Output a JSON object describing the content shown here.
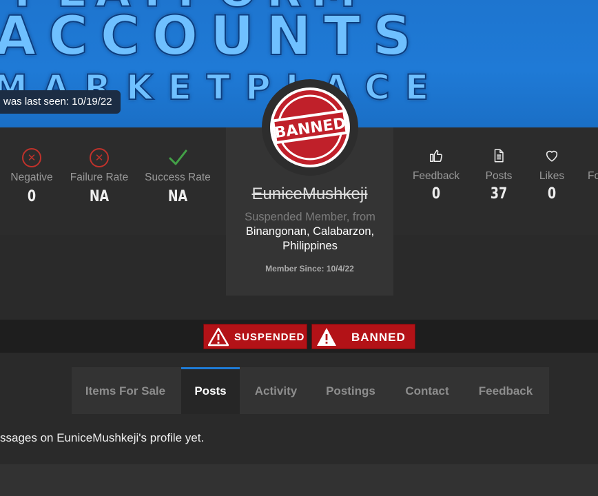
{
  "banner": {
    "line1": "PLATFORM",
    "line2": "ACCOUNTS",
    "line3": "MARKETPLACE",
    "last_seen": "was last seen: 10/19/22"
  },
  "stats_left": [
    {
      "label": "Negative",
      "value": "0",
      "icon": "x-circle-icon"
    },
    {
      "label": "Failure Rate",
      "value": "NA",
      "icon": "x-circle-icon"
    },
    {
      "label": "Success Rate",
      "value": "NA",
      "icon": "check-icon"
    }
  ],
  "stats_right": [
    {
      "label": "Feedback",
      "value": "0",
      "icon": "thumbs-up-icon"
    },
    {
      "label": "Posts",
      "value": "37",
      "icon": "document-icon"
    },
    {
      "label": "Likes",
      "value": "0",
      "icon": "heart-icon"
    },
    {
      "label": "Fo",
      "value": "",
      "icon": "followers-icon"
    }
  ],
  "profile": {
    "avatar_text": "BANNED",
    "username": "EuniceMushkeji",
    "title": "Suspended Member",
    "from_word": ", from",
    "location": "Binangonan, Calabarzon, Philippines",
    "member_since": "Member Since: 10/4/22"
  },
  "badges": [
    {
      "label": "SUSPENDED"
    },
    {
      "label": "BANNED"
    }
  ],
  "tabs": [
    {
      "label": "Items For Sale",
      "active": false
    },
    {
      "label": "Posts",
      "active": true
    },
    {
      "label": "Activity",
      "active": false
    },
    {
      "label": "Postings",
      "active": false
    },
    {
      "label": "Contact",
      "active": false
    },
    {
      "label": "Feedback",
      "active": false
    }
  ],
  "content": {
    "message": "ssages on EuniceMushkeji's profile yet."
  },
  "colors": {
    "accent": "#1e7bd6",
    "banner_blue": "#1f7ad6",
    "danger": "#b31217",
    "success": "#4caf50"
  }
}
